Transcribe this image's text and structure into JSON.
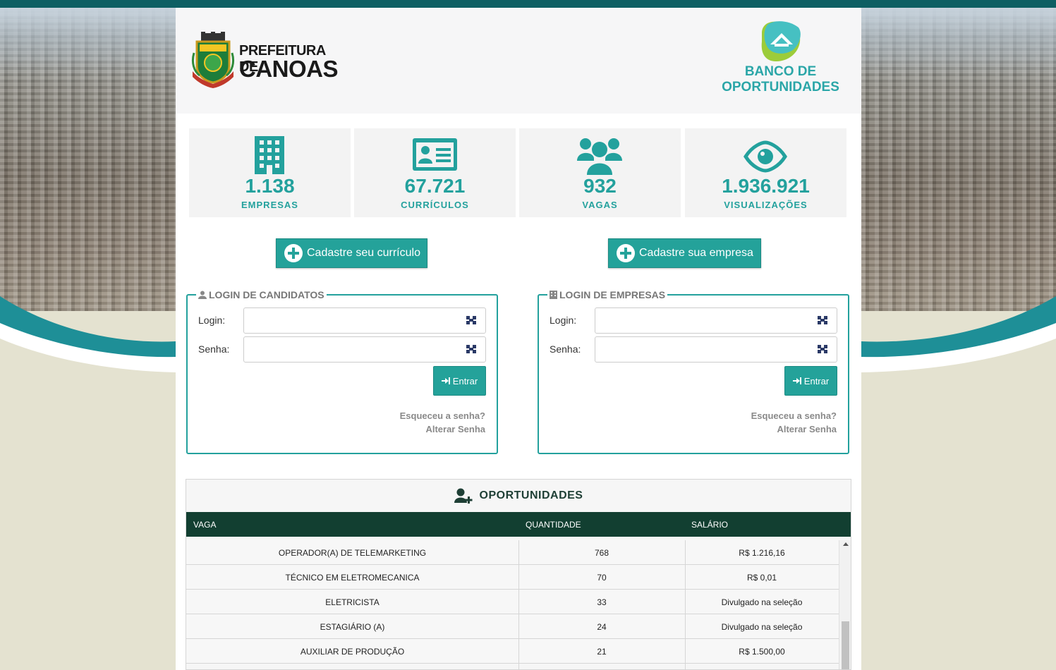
{
  "header": {
    "prefeitura_line1": "PREFEITURA DE",
    "prefeitura_line2": "CANOAS",
    "banco_line1": "BANCO DE",
    "banco_line2": "OPORTUNIDADES"
  },
  "stats": [
    {
      "icon": "building-icon",
      "value": "1.138",
      "label": "EMPRESAS"
    },
    {
      "icon": "id-card-icon",
      "value": "67.721",
      "label": "CURRÍCULOS"
    },
    {
      "icon": "users-icon",
      "value": "932",
      "label": "VAGAS"
    },
    {
      "icon": "eye-icon",
      "value": "1.936.921",
      "label": "VISUALIZAÇÕES"
    }
  ],
  "cta": {
    "register_cv": "Cadastre seu currículo",
    "register_company": "Cadastre sua empresa"
  },
  "login_candidates": {
    "title": "LOGIN DE CANDIDATOS",
    "login_label": "Login:",
    "password_label": "Senha:",
    "login_value": "",
    "password_value": "",
    "enter_label": "Entrar",
    "forgot": "Esqueceu a senha?",
    "change": "Alterar Senha"
  },
  "login_companies": {
    "title": "LOGIN DE EMPRESAS",
    "login_label": "Login:",
    "password_label": "Senha:",
    "login_value": "",
    "password_value": "",
    "enter_label": "Entrar",
    "forgot": "Esqueceu a senha?",
    "change": "Alterar Senha"
  },
  "opportunities": {
    "title": "OPORTUNIDADES",
    "columns": [
      "VAGA",
      "QUANTIDADE",
      "SALÁRIO"
    ],
    "rows": [
      [
        "OPERADOR(A) DE TELEMARKETING",
        "768",
        "R$ 1.216,16"
      ],
      [
        "TÉCNICO EM ELETROMECANICA",
        "70",
        "R$ 0,01"
      ],
      [
        "ELETRICISTA",
        "33",
        "Divulgado na seleção"
      ],
      [
        "ESTAGIÁRIO (A)",
        "24",
        "Divulgado na seleção"
      ],
      [
        "AUXILIAR DE PRODUÇÃO",
        "21",
        "R$ 1.500,00"
      ]
    ]
  },
  "colors": {
    "accent": "#24a29a",
    "table_header": "#123f31",
    "top_bar": "#0d5f63",
    "page_bg": "#e4e2d0"
  }
}
